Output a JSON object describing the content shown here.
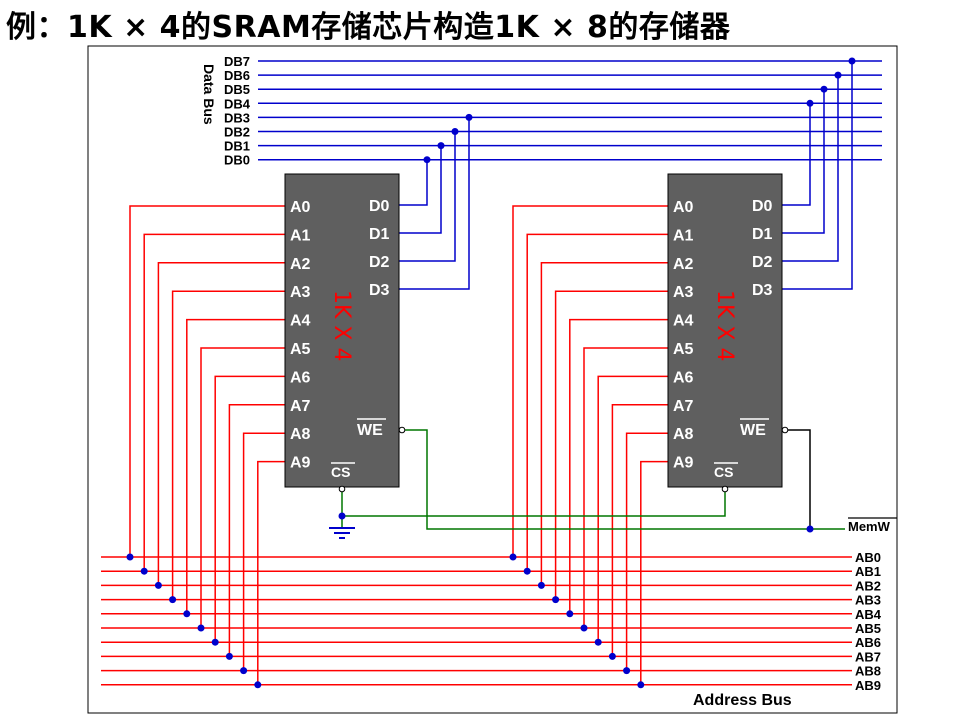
{
  "title": "例：1K × 4的SRAM存储芯片构造1K × 8的存储器",
  "colors": {
    "address": "#ff0000",
    "data": "#0000cc",
    "control": "#007700",
    "chip_fill": "#5f5f5f",
    "chip_label": "#ff0000",
    "node": "#0000cc"
  },
  "data_bus": {
    "label": "Data  Bus",
    "lines": [
      "DB7",
      "DB6",
      "DB5",
      "DB4",
      "DB3",
      "DB2",
      "DB1",
      "DB0"
    ]
  },
  "address_bus": {
    "label": "Address  Bus",
    "lines": [
      "AB0",
      "AB1",
      "AB2",
      "AB3",
      "AB4",
      "AB5",
      "AB6",
      "AB7",
      "AB8",
      "AB9"
    ]
  },
  "chips": [
    {
      "label": "1K X 4",
      "address_pins": [
        "A0",
        "A1",
        "A2",
        "A3",
        "A4",
        "A5",
        "A6",
        "A7",
        "A8",
        "A9"
      ],
      "data_pins": [
        "D0",
        "D1",
        "D2",
        "D3"
      ],
      "we_pin": "WE",
      "cs_pin": "CS",
      "data_bus_connections": [
        "DB0",
        "DB1",
        "DB2",
        "DB3"
      ]
    },
    {
      "label": "1K X 4",
      "address_pins": [
        "A0",
        "A1",
        "A2",
        "A3",
        "A4",
        "A5",
        "A6",
        "A7",
        "A8",
        "A9"
      ],
      "data_pins": [
        "D0",
        "D1",
        "D2",
        "D3"
      ],
      "we_pin": "WE",
      "cs_pin": "CS",
      "data_bus_connections": [
        "DB4",
        "DB5",
        "DB6",
        "DB7"
      ]
    }
  ],
  "control": {
    "write_signal": "MemW",
    "cs_connection": "ground"
  }
}
